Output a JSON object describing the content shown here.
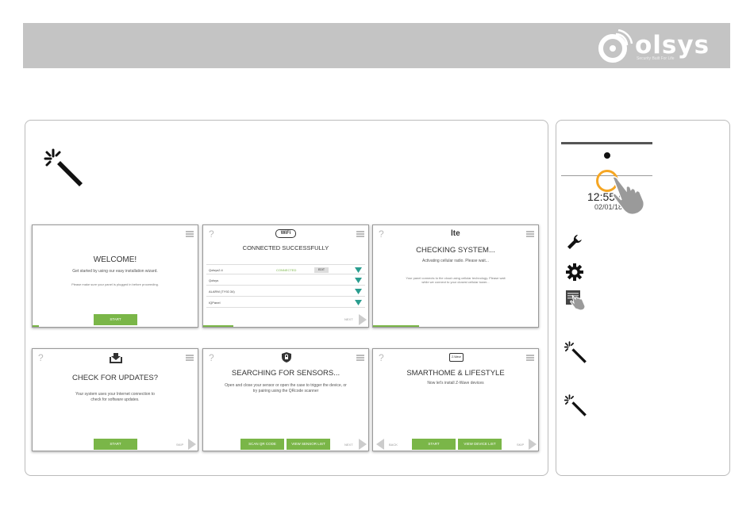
{
  "header": {
    "logo": {
      "brand": "olsys",
      "tagline": "Security Built For Life"
    },
    "colors": {
      "bar": "#c4c4c4",
      "accent": "#7ab648",
      "orange": "#f5a623"
    }
  },
  "screens": {
    "welcome": {
      "title": "WELCOME!",
      "text": "Get started by using our easy installation wizard.",
      "note": "Please make sure your panel is plugged in before proceeding.",
      "button": "START"
    },
    "wifi": {
      "badge": "WiFi",
      "title": "CONNECTED SUCCESSFULLY",
      "networks": [
        {
          "name": "Qolsys2.4",
          "status": "CONNECTED",
          "action": "EDIT"
        },
        {
          "name": "Qolsys",
          "status": "",
          "action": ""
        },
        {
          "name": "ALARM (TY92.34)",
          "status": "",
          "action": ""
        },
        {
          "name": "IQPanel",
          "status": "",
          "action": ""
        }
      ],
      "next": "NEXT"
    },
    "lte": {
      "badge": "lte",
      "title": "CHECKING SYSTEM...",
      "text": "Activating cellular radio. Please wait...",
      "note": "Your panel connects to the cloud using cellular technology. Please wait while we connect to your closest cellular tower..."
    },
    "updates": {
      "title": "CHECK FOR UPDATES?",
      "text": "Your system uses your Internet connection to check for software updates.",
      "button": "START",
      "skip": "SKIP"
    },
    "sensors": {
      "title": "SEARCHING FOR SENSORS...",
      "text": "Open and close your sensor or open the case to trigger the device, or try pairing using the QRcode scanner",
      "button1": "SCAN QR CODE",
      "button2": "VIEW SENSOR LIST",
      "next": "NEXT"
    },
    "smarthome": {
      "badge": "Z-Wave",
      "title": "SMARTHOME & LIFESTYLE",
      "text": "Now let's install Z-Wave devices",
      "back": "BACK",
      "button1": "START",
      "button2": "VIEW DEVICE LIST",
      "skip": "SKIP"
    }
  },
  "side": {
    "clock": "12:55 PM",
    "date": "02/01/18"
  }
}
